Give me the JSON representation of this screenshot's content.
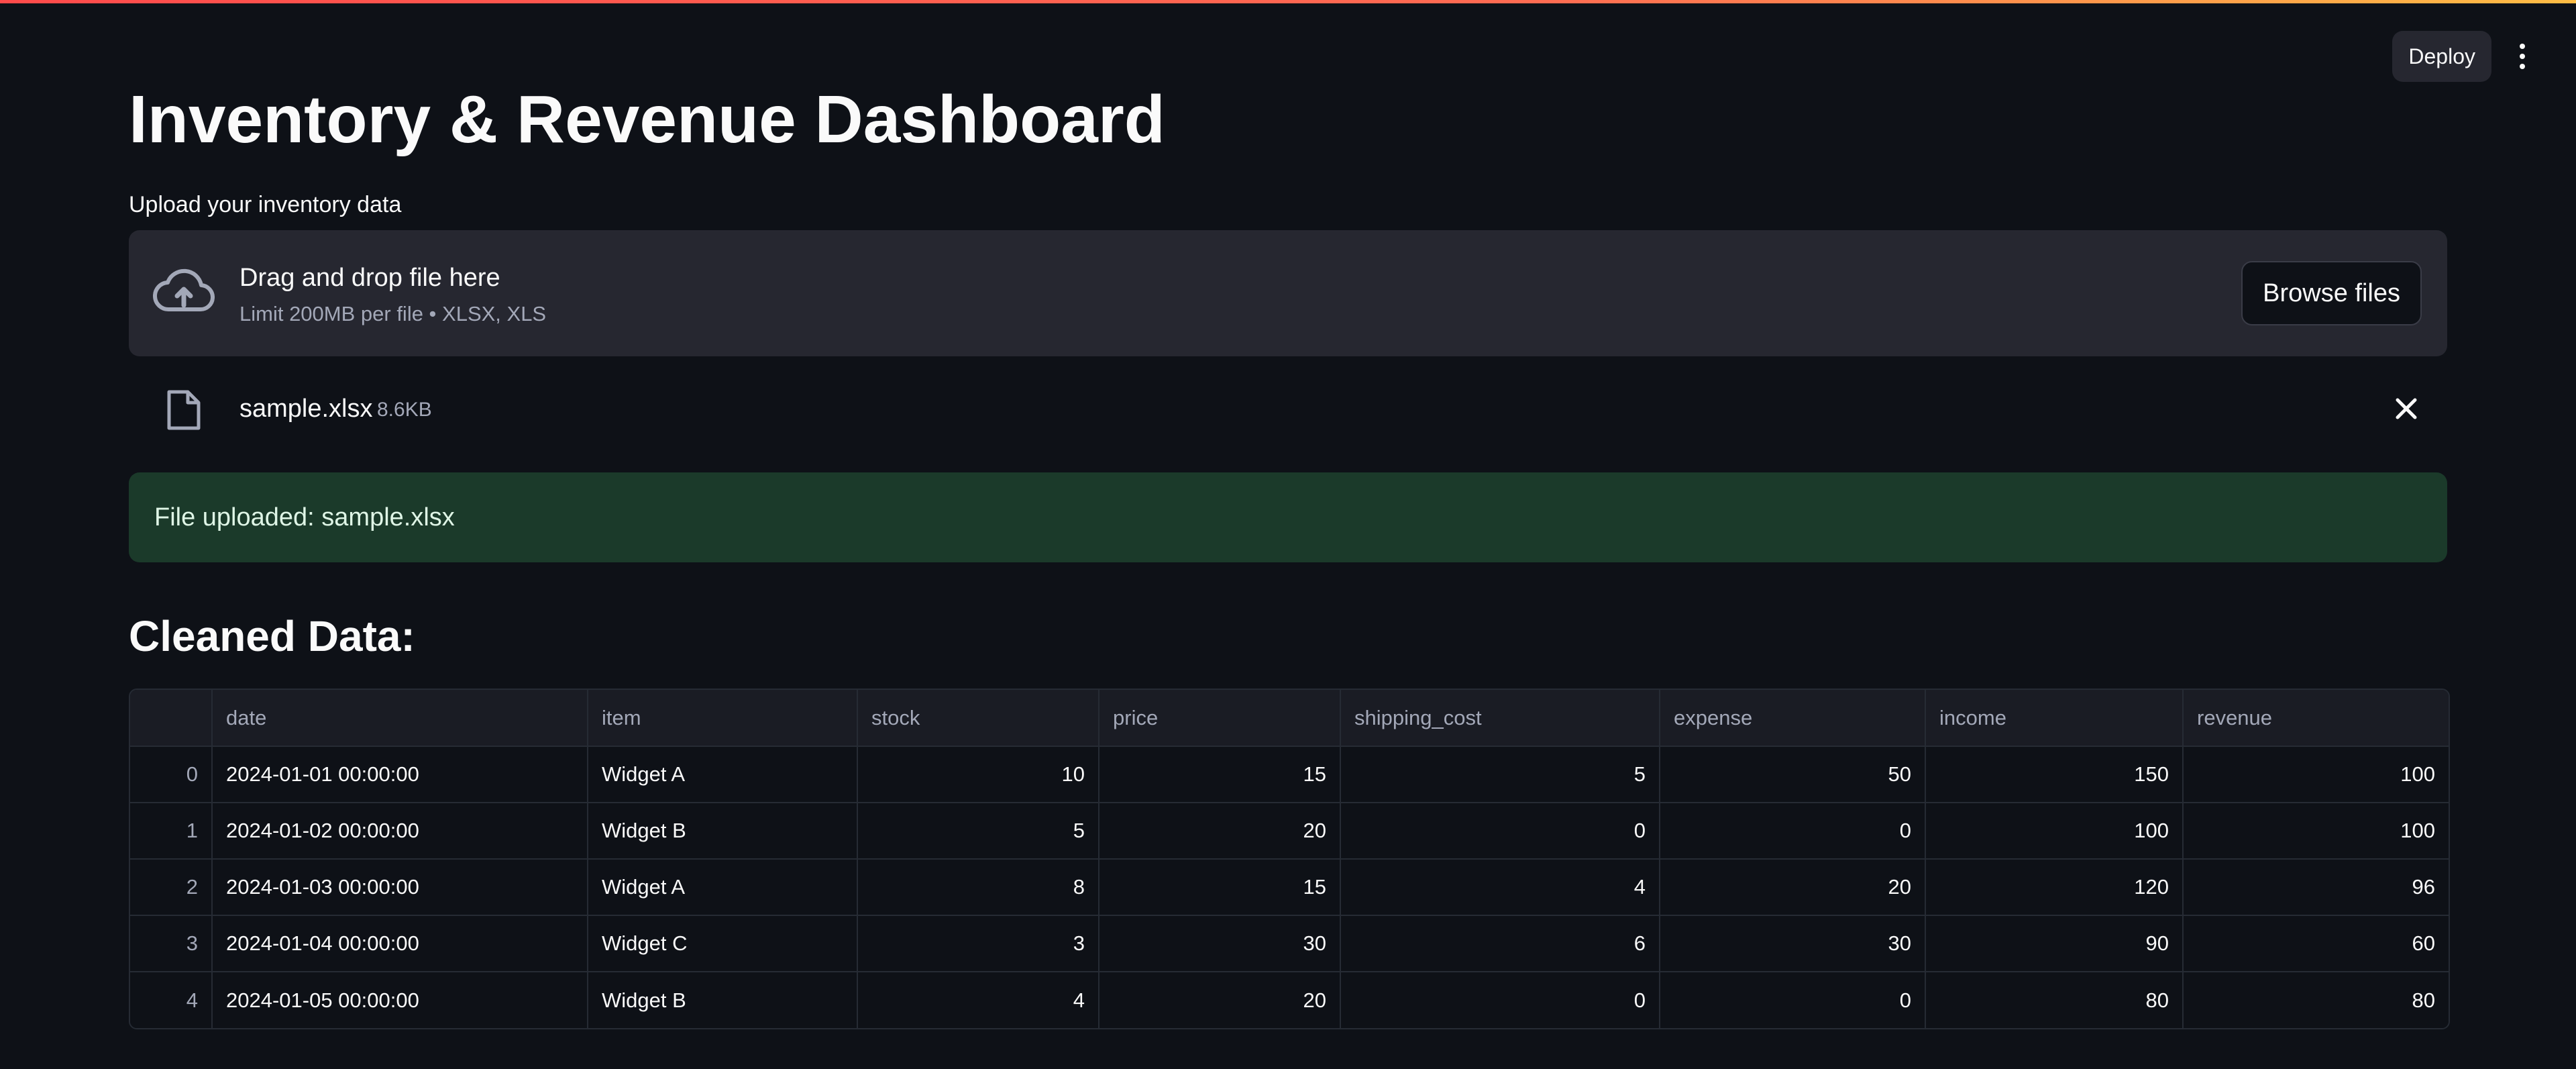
{
  "header": {
    "deploy_label": "Deploy",
    "menu_icon": "kebab-menu-icon"
  },
  "page": {
    "title": "Inventory & Revenue Dashboard"
  },
  "uploader": {
    "label": "Upload your inventory data",
    "drop_text": "Drag and drop file here",
    "limit_text": "Limit 200MB per file • XLSX, XLS",
    "browse_label": "Browse files",
    "icon": "cloud-upload-icon"
  },
  "uploaded_file": {
    "name": "sample.xlsx",
    "size": "8.6KB",
    "icon": "file-icon",
    "remove_icon": "close-icon"
  },
  "alert": {
    "text": "File uploaded: sample.xlsx",
    "color": "#1b3a2a"
  },
  "section": {
    "heading": "Cleaned Data:"
  },
  "table": {
    "columns": [
      "",
      "date",
      "item",
      "stock",
      "price",
      "shipping_cost",
      "expense",
      "income",
      "revenue"
    ],
    "rows": [
      [
        "0",
        "2024-01-01 00:00:00",
        "Widget A",
        "10",
        "15",
        "5",
        "50",
        "150",
        "100"
      ],
      [
        "1",
        "2024-01-02 00:00:00",
        "Widget B",
        "5",
        "20",
        "0",
        "0",
        "100",
        "100"
      ],
      [
        "2",
        "2024-01-03 00:00:00",
        "Widget A",
        "8",
        "15",
        "4",
        "20",
        "120",
        "96"
      ],
      [
        "3",
        "2024-01-04 00:00:00",
        "Widget C",
        "3",
        "30",
        "6",
        "30",
        "90",
        "60"
      ],
      [
        "4",
        "2024-01-05 00:00:00",
        "Widget B",
        "4",
        "20",
        "0",
        "0",
        "80",
        "80"
      ]
    ]
  },
  "colors": {
    "background": "#0e1117",
    "accent_gradient_start": "#ff4b4b",
    "accent_gradient_end": "#ffbd45",
    "success_background": "#1b3a2a"
  }
}
